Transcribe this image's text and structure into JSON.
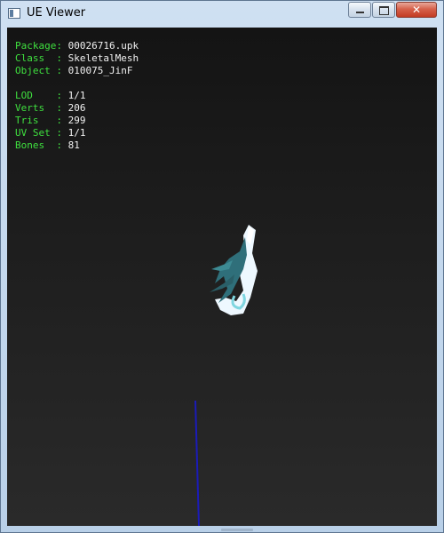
{
  "window": {
    "title": "UE Viewer",
    "close_symbol": "✕"
  },
  "info": {
    "package": {
      "label": "Package:",
      "value": "00026716.upk"
    },
    "class": {
      "label": "Class  :",
      "value": "SkeletalMesh"
    },
    "object": {
      "label": "Object :",
      "value": "010075_JinF"
    },
    "lod": {
      "label": "LOD    :",
      "value": "1/1"
    },
    "verts": {
      "label": "Verts  :",
      "value": "206"
    },
    "tris": {
      "label": "Tris   :",
      "value": "299"
    },
    "uvset": {
      "label": "UV Set :",
      "value": "1/1"
    },
    "bones": {
      "label": "Bones  :",
      "value": "81"
    }
  },
  "colors": {
    "label_green": "#3fe03f",
    "value_white": "#f2f2f2",
    "axis_blue": "#1b1bb8",
    "mesh_teal": "#2f6f7a"
  },
  "icons": {
    "app": "app-window-icon",
    "minimize": "minimize-icon",
    "maximize": "maximize-icon",
    "close": "close-icon"
  }
}
